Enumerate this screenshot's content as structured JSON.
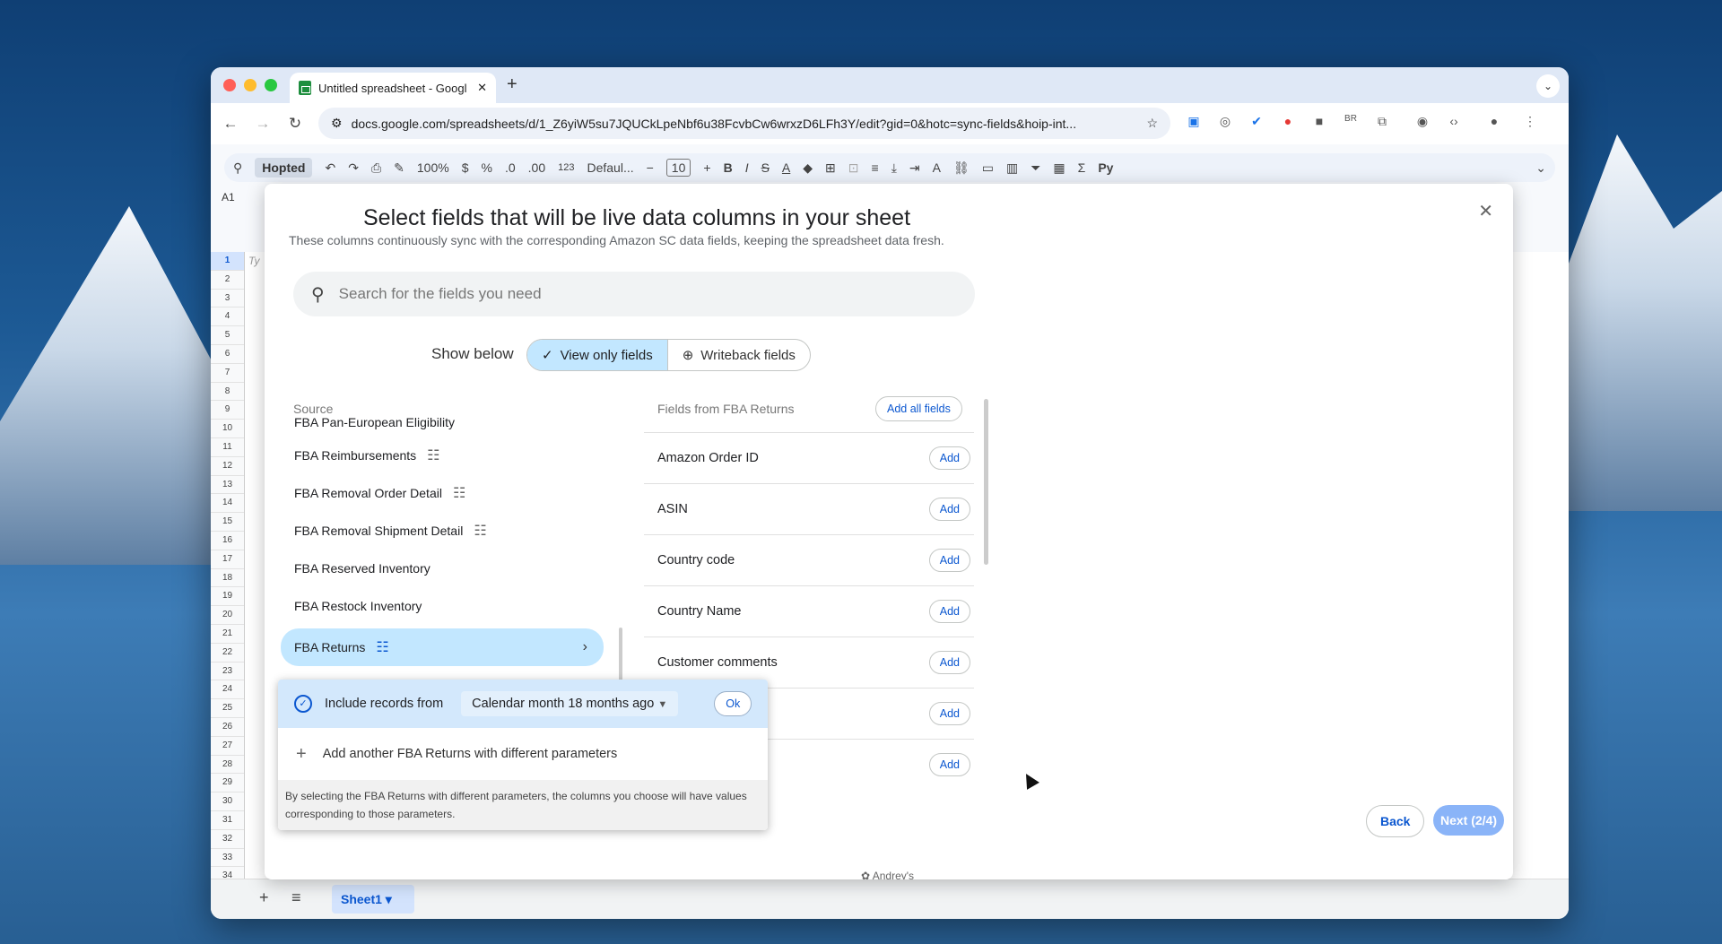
{
  "browser": {
    "tab_title": "Untitled spreadsheet - Googl",
    "url": "docs.google.com/spreadsheets/d/1_Z6yiW5su7JQUCkLpeNbf6u38FcvbCw6wrxzD6LFh3Y/edit?gid=0&hotc=sync-fields&hoip-int..."
  },
  "toolbar": {
    "addon_menu": "Hopted",
    "zoom": "100%",
    "currency": "$",
    "percent": "%",
    "dec_less": ".0",
    ".dec_more": ".00",
    "dec_more": ".00",
    "number_format": "123",
    "font": "Defaul...",
    "font_size": "10",
    "bold": "B",
    "italic": "I",
    "functions": "Σ",
    "extra": "Py"
  },
  "namebox": "A1",
  "rows": [
    "1",
    "2",
    "3",
    "4",
    "5",
    "6",
    "7",
    "8",
    "9",
    "10",
    "11",
    "12",
    "13",
    "14",
    "15",
    "16",
    "17",
    "18",
    "19",
    "20",
    "21",
    "22",
    "23",
    "24",
    "25",
    "26",
    "27",
    "28",
    "29",
    "30",
    "31",
    "32",
    "33",
    "34"
  ],
  "cell_a1_hint": "Ty",
  "sheet_tab": "Sheet1",
  "modal": {
    "title": "Select fields that will be live data columns in your sheet",
    "subtitle": "These columns continuously sync with the corresponding Amazon SC data fields, keeping the spreadsheet data fresh.",
    "search_placeholder": "Search for the fields you need",
    "show_below": "Show below",
    "view_only": "View only fields",
    "writeback": "Writeback fields",
    "source_label": "Source",
    "sources": [
      {
        "label": "FBA Pan-European Eligibility",
        "tune": false
      },
      {
        "label": "FBA Reimbursements",
        "tune": true
      },
      {
        "label": "FBA Removal Order Detail",
        "tune": true
      },
      {
        "label": "FBA Removal Shipment Detail",
        "tune": true
      },
      {
        "label": "FBA Reserved Inventory",
        "tune": false
      },
      {
        "label": "FBA Restock Inventory",
        "tune": false
      },
      {
        "label": "FBA Returns",
        "tune": true
      }
    ],
    "fields_header": "Fields from FBA Returns",
    "add_all": "Add all fields",
    "fields": [
      "Amazon Order ID",
      "ASIN",
      "Country code",
      "Country Name",
      "Customer comments",
      "",
      ""
    ],
    "add_label": "Add",
    "popup": {
      "include_label": "Include records from",
      "period": "Calendar month 18 months ago",
      "ok": "Ok",
      "add_another": "Add another FBA Returns with different parameters",
      "note": "By selecting the FBA Returns with different parameters, the columns you choose will have values corresponding to those parameters."
    },
    "back": "Back",
    "next": "Next (2/4)",
    "footnote": "Andrey's"
  }
}
